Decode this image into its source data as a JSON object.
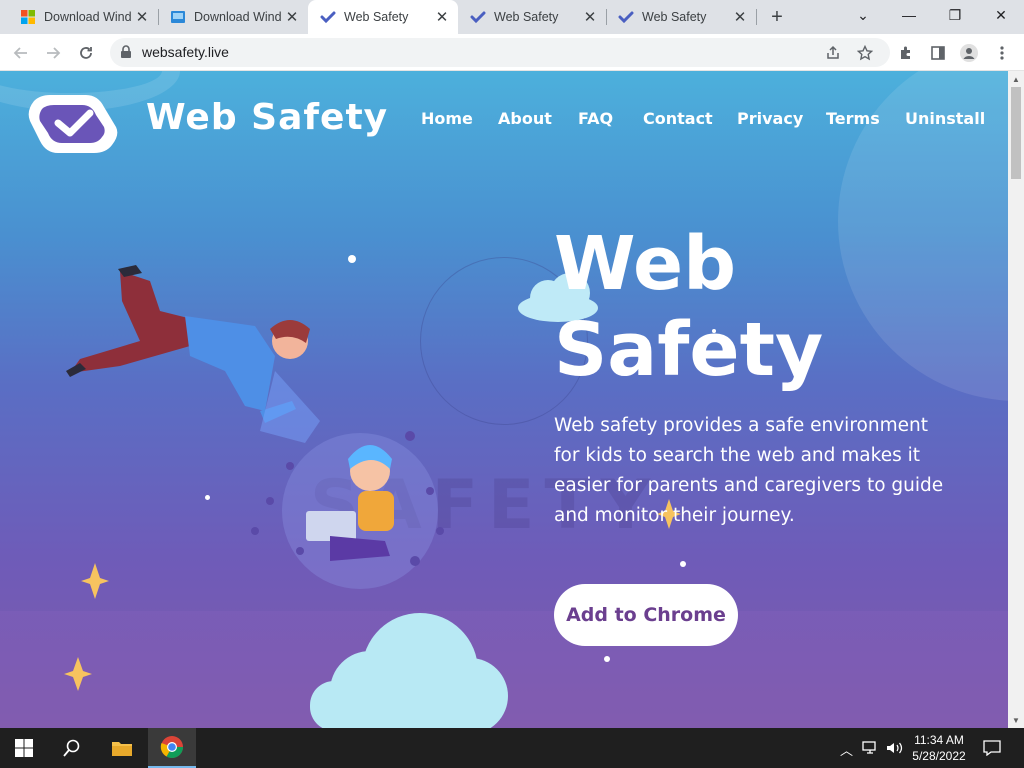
{
  "browser": {
    "tabs": [
      {
        "title": "Download Windo",
        "icon": "windows-logo-icon",
        "active": false
      },
      {
        "title": "Download Windo",
        "icon": "windows-media-icon",
        "active": false
      },
      {
        "title": "Web Safety",
        "icon": "web-safety-favicon",
        "active": true
      },
      {
        "title": "Web Safety",
        "icon": "web-safety-favicon",
        "active": false
      },
      {
        "title": "Web Safety",
        "icon": "web-safety-favicon",
        "active": false
      }
    ],
    "new_tab": "+",
    "window_controls": {
      "list": "⌄",
      "minimize": "—",
      "restore": "❐",
      "close": "✕"
    },
    "url": "websafety.live"
  },
  "site": {
    "title": "Web Safety",
    "nav": [
      "Home",
      "About",
      "FAQ",
      "Contact",
      "Privacy",
      "Terms",
      "Uninstall"
    ],
    "hero_line1": "Web",
    "hero_line2": "Safety",
    "description": "Web safety provides a safe environment for kids to search the web and makes it easier for parents and caregivers to guide and monitor their journey.",
    "cta": "Add to Chrome",
    "watermark": "SAFETY",
    "colors": {
      "gradient_top": "#4cb0dc",
      "gradient_bottom": "#7f5aaa",
      "cta_text": "#6b3f8f"
    }
  },
  "taskbar": {
    "time": "11:34 AM",
    "date": "5/28/2022"
  }
}
